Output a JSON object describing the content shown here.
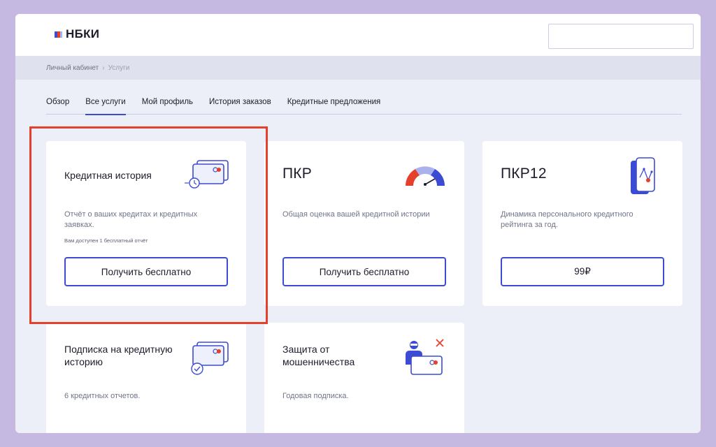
{
  "header": {
    "logo_text": "НБКИ"
  },
  "breadcrumb": {
    "items": [
      "Личный кабинет",
      "Услуги"
    ],
    "separator": "›"
  },
  "tabs": [
    {
      "label": "Обзор",
      "active": false
    },
    {
      "label": "Все услуги",
      "active": true
    },
    {
      "label": "Мой профиль",
      "active": false
    },
    {
      "label": "История заказов",
      "active": false
    },
    {
      "label": "Кредитные предложения",
      "active": false
    }
  ],
  "cards": [
    {
      "title": "Кредитная история",
      "description": "Отчёт о ваших кредитах и кредитных заявках.",
      "note": "Вам доступен 1 бесплатный отчёт",
      "button_label": "Получить бесплатно",
      "icon": "credit-card-history-icon"
    },
    {
      "title": "ПКР",
      "description": "Общая оценка вашей кредитной истории",
      "button_label": "Получить бесплатно",
      "icon": "speedometer-icon"
    },
    {
      "title": "ПКР12",
      "description": "Динамика персонального кредитного рейтинга за год.",
      "button_label": "99₽",
      "icon": "phone-chart-icon"
    },
    {
      "title": "Подписка на кредитную историю",
      "description": "6 кредитных отчетов.",
      "icon": "card-check-icon"
    },
    {
      "title": "Защита от мошенничества",
      "description": "Годовая подписка.",
      "icon": "fraud-protection-icon"
    }
  ],
  "colors": {
    "accent": "#3c4bd3",
    "highlight": "#e4402c",
    "outer_background": "#c5b9e2",
    "page_background": "#eceef8"
  }
}
